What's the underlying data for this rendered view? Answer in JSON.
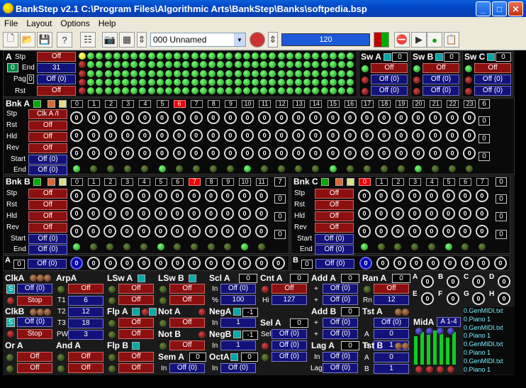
{
  "window": {
    "title": "BankStep v2.1  C:\\Program Files\\Algorithmic Arts\\BankStep\\Banks\\softpedia.bsp",
    "min": "_",
    "max": "□",
    "close": "✕"
  },
  "menu": [
    "File",
    "Layout",
    "Options",
    "Help"
  ],
  "toolbar": {
    "pattern": "000 Unnamed",
    "tempo": "120"
  },
  "seqA": {
    "label": "A",
    "stp_label": "Stp",
    "stp": "Off",
    "end_label": "End",
    "end": "31",
    "pag_label": "Pag",
    "pag_value": "0",
    "pag": "Off (0)",
    "rst_label": "Rst",
    "rst": "Off"
  },
  "switches": [
    {
      "label": "Sw A",
      "v": "0",
      "off": "Off",
      "off0a": "Off (0)",
      "off0b": "Off (0)"
    },
    {
      "label": "Sw B",
      "v": "0",
      "off": "Off",
      "off0a": "Off (0)",
      "off0b": "Off (0)"
    },
    {
      "label": "Sw C",
      "v": "0",
      "off": "Off",
      "off0a": "Off (0)",
      "off0b": "Off (0)"
    }
  ],
  "bankA": {
    "label": "Bnk A",
    "steps": [
      "0",
      "1",
      "2",
      "3",
      "4",
      "5",
      "6",
      "7",
      "8",
      "9",
      "10",
      "11",
      "12",
      "13",
      "14",
      "15",
      "16",
      "17",
      "18",
      "19",
      "20",
      "21",
      "22",
      "23"
    ],
    "end_step": "6",
    "clk_label": "Stp",
    "clk": "Clk A /I",
    "rst_label": "Rst",
    "rst": "Off",
    "hld_label": "Hld",
    "hld": "Off",
    "rev_label": "Rev",
    "rev": "Off",
    "start_label": "Start",
    "start": "Off (0)",
    "end_label": "End",
    "end": "Off (0)",
    "row_values": [
      "0",
      "0",
      "0"
    ]
  },
  "bankB": {
    "label": "Bnk B",
    "steps": [
      "0",
      "1",
      "2",
      "3",
      "4",
      "5",
      "6",
      "7",
      "8",
      "9",
      "10",
      "11"
    ],
    "end_step": "7",
    "stp": "Off",
    "rst": "Off",
    "hld": "Off",
    "rev": "Off",
    "start": "Off (0)",
    "end": "Off (0)",
    "row_values": [
      "0",
      "0",
      "0"
    ],
    "labels": {
      "stp": "Stp",
      "rst": "Rst",
      "hld": "Hld",
      "rev": "Rev",
      "start": "Start",
      "end": "End"
    }
  },
  "bankC": {
    "label": "Bnk C",
    "steps": [
      "0",
      "1",
      "2",
      "3",
      "4",
      "5",
      "6",
      "7"
    ],
    "end_step": "0",
    "stp": "Off",
    "rst": "Off",
    "hld": "Off",
    "rev": "Off",
    "start": "Off (0)",
    "end": "Off (0)",
    "row_values": [
      "0",
      "0",
      "0"
    ],
    "labels": {
      "stp": "Stp",
      "rst": "Rst",
      "hld": "Hld",
      "rev": "Rev",
      "start": "Start",
      "end": "End"
    }
  },
  "rowA": {
    "label": "A",
    "value": "0",
    "off": "Off (0)",
    "knob": "0"
  },
  "rowB": {
    "label": "B",
    "value": "0",
    "off": "Off (0)",
    "knob": "0"
  },
  "knobZero": "0",
  "mods": {
    "clkA": {
      "label": "ClkA",
      "s": "S",
      "off": "Off (0)",
      "stop": "Stop"
    },
    "clkB": {
      "label": "ClkB",
      "s": "S",
      "off": "Off (0)",
      "stop": "Stop"
    },
    "arpA": {
      "label": "ArpA",
      "off": "Off",
      "t1_label": "T1",
      "t1": "6",
      "t2_label": "T2",
      "t2": "12",
      "t3_label": "T3",
      "t3": "18",
      "pw_label": "PW",
      "pw": "3"
    },
    "orA": {
      "label": "Or A",
      "off1": "Off",
      "off2": "Off"
    },
    "andA": {
      "label": "And A",
      "off1": "Off",
      "off2": "Off"
    },
    "lswA": {
      "label": "LSw A",
      "off1": "Off",
      "off2": "Off"
    },
    "lswB": {
      "label": "LSw B",
      "off1": "Off",
      "off2": "Off"
    },
    "flpA": {
      "label": "Flp A",
      "off1": "Off",
      "off2": "Off"
    },
    "flpB": {
      "label": "Flp B",
      "off1": "Off",
      "off2": "Off"
    },
    "notA": {
      "label": "Not A",
      "off": "Off"
    },
    "notB": {
      "label": "Not B",
      "off": "Off"
    },
    "semA": {
      "label": "Sem A",
      "v": "0",
      "in_label": "In",
      "in": "Off (0)"
    },
    "sclA": {
      "label": "Scl A",
      "v": "0",
      "in_label": "In",
      "in": "Off (0)",
      "pct_label": "%",
      "pct": "100"
    },
    "negA": {
      "label": "NegA",
      "v": "-1",
      "in_label": "In",
      "in": "1"
    },
    "negB": {
      "label": "NegB",
      "v": "-1",
      "in_label": "In",
      "in": "1"
    },
    "octA": {
      "label": "OctA",
      "v": "0",
      "in_label": "In",
      "in": "Off (0)"
    },
    "cntA": {
      "label": "Cnt A",
      "v": "0",
      "off": "Off",
      "hi_label": "Hi",
      "hi": "127"
    },
    "selA": {
      "label": "Sel A",
      "v": "0",
      "sel_label": "Sel",
      "sel": "Off (0)",
      "off1": "Off (0)",
      "off2": "Off (0)"
    },
    "addA": {
      "label": "Add A",
      "v": "0",
      "a": "Off (0)",
      "b": "Off (0)",
      "op": "+"
    },
    "addB": {
      "label": "Add B",
      "v": "0",
      "a": "Off (0)",
      "b": "Off (0)",
      "op": "+"
    },
    "lagA": {
      "label": "Lag A",
      "v": "0",
      "in_label": "In",
      "in": "Off (0)",
      "lag_label": "Lag",
      "lag": "Off (0)"
    },
    "ranA": {
      "label": "Ran A",
      "v": "0",
      "off": "Off",
      "rn_label": "Rn",
      "rn": "12"
    },
    "tstA": {
      "label": "Tst A",
      "off": "Off (0)",
      "a_label": "A",
      "a": "0",
      "b_label": "B",
      "b": "1"
    },
    "tstB": {
      "label": "Tst B",
      "off": "Off (0)",
      "a_label": "A",
      "a": "0",
      "b_label": "B",
      "b": "1"
    },
    "midA": {
      "label": "MidA",
      "v": "A 1-4"
    },
    "knobsABCD": [
      "A",
      "B",
      "C",
      "D"
    ],
    "knobsEFGH": [
      "E",
      "F",
      "G",
      "H"
    ]
  },
  "files": [
    "0.GenMIDI.txt",
    "0.Piano 1",
    "0.GenMIDI.txt",
    "0.Piano 1",
    "0.GenMIDI.txt",
    "0.Piano 1",
    "0.GenMIDI.txt",
    "0.Piano 1"
  ],
  "watermark": "SOFTPEDIA"
}
